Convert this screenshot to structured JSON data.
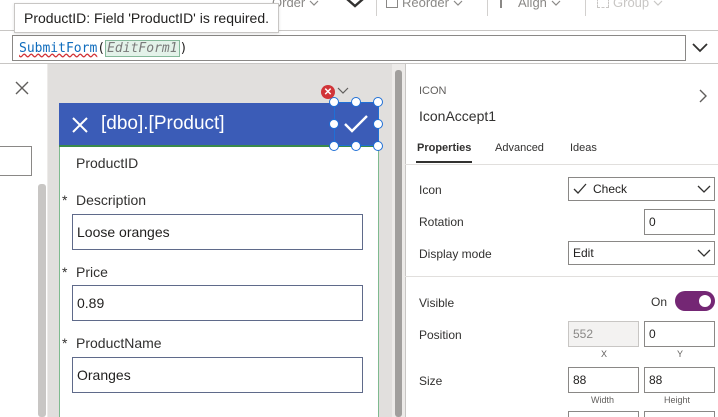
{
  "ribbon": {
    "order_label": "Order",
    "reorder_label": "Reorder",
    "align_label": "Align",
    "group_label": "Group"
  },
  "tooltip": {
    "text": "ProductID: Field 'ProductID' is required."
  },
  "formula": {
    "function": "SubmitForm",
    "open_paren": "(",
    "argument": "EditForm1",
    "close_paren": ")"
  },
  "form": {
    "title": "[dbo].[Product]",
    "fields": [
      {
        "label": "ProductID",
        "required": false,
        "value": ""
      },
      {
        "label": "Description",
        "required": true,
        "value": "Loose oranges"
      },
      {
        "label": "Price",
        "required": true,
        "value": "0.89"
      },
      {
        "label": "ProductName",
        "required": true,
        "value": "Oranges"
      }
    ],
    "required_mark": "*"
  },
  "properties": {
    "type": "ICON",
    "name": "IconAccept1",
    "tabs": [
      {
        "label": "Properties",
        "active": true
      },
      {
        "label": "Advanced",
        "active": false
      },
      {
        "label": "Ideas",
        "active": false
      }
    ],
    "icon": {
      "label": "Icon",
      "value": "Check"
    },
    "rotation": {
      "label": "Rotation",
      "value": "0"
    },
    "display_mode": {
      "label": "Display mode",
      "value": "Edit"
    },
    "visible": {
      "label": "Visible",
      "state": "On"
    },
    "position": {
      "label": "Position",
      "x": "552",
      "y": "0",
      "x_caption": "X",
      "y_caption": "Y"
    },
    "size": {
      "label": "Size",
      "width": "88",
      "height": "88",
      "width_caption": "Width",
      "height_caption": "Height"
    }
  },
  "colors": {
    "form_header": "#3b5cb7",
    "toggle_on": "#742774",
    "error": "#d13438",
    "selection": "#1f6fd6"
  }
}
